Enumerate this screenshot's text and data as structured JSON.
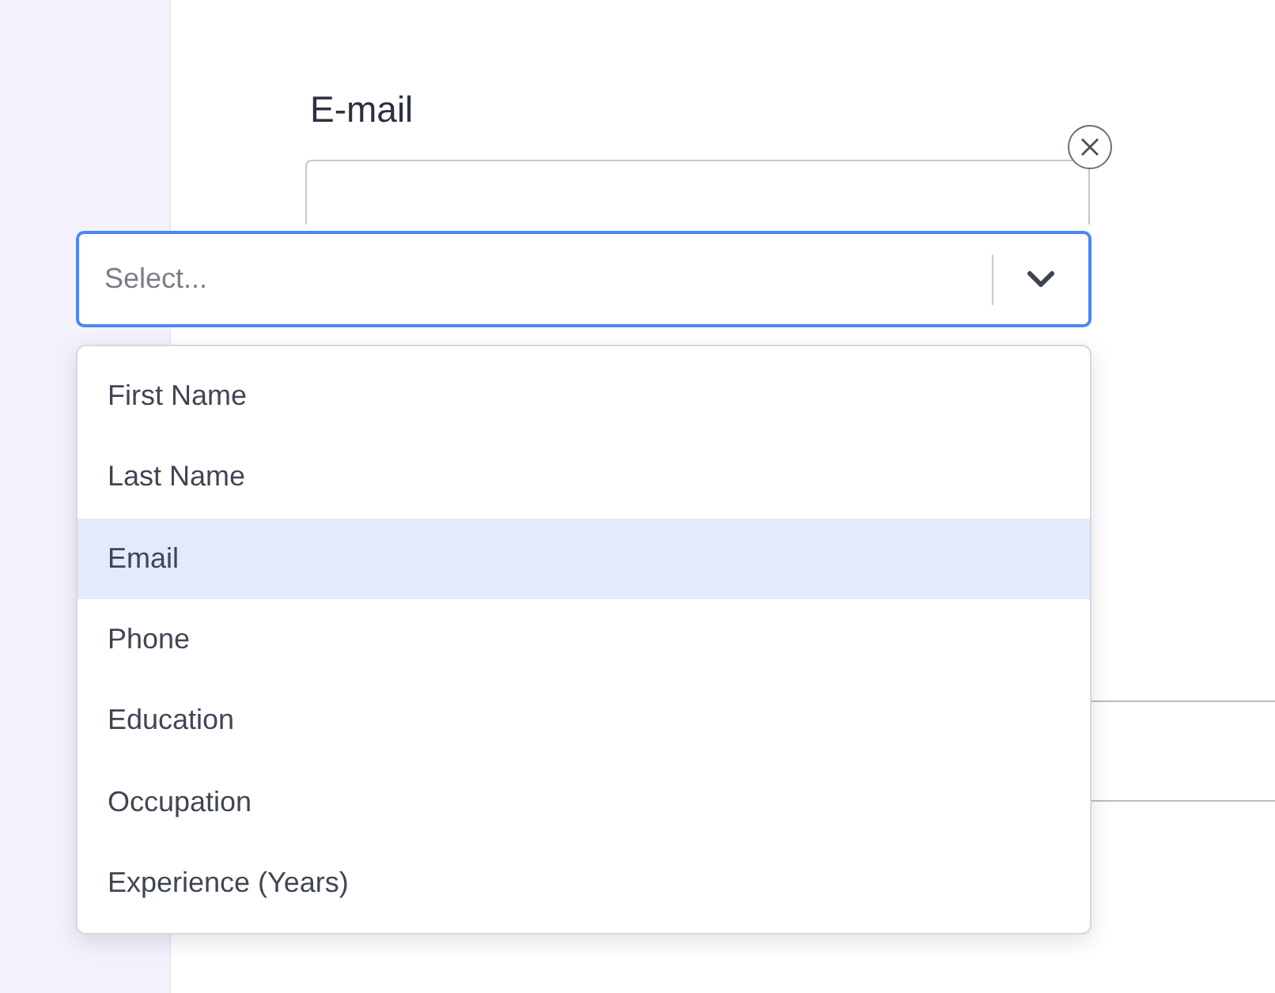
{
  "field": {
    "label": "E-mail"
  },
  "select": {
    "placeholder": "Select...",
    "expanded": true
  },
  "options": [
    {
      "label": "First Name",
      "selected": false
    },
    {
      "label": "Last Name",
      "selected": false
    },
    {
      "label": "Email",
      "selected": true
    },
    {
      "label": "Phone",
      "selected": false
    },
    {
      "label": "Education",
      "selected": false
    },
    {
      "label": "Occupation",
      "selected": false
    },
    {
      "label": "Experience (Years)",
      "selected": false
    }
  ]
}
